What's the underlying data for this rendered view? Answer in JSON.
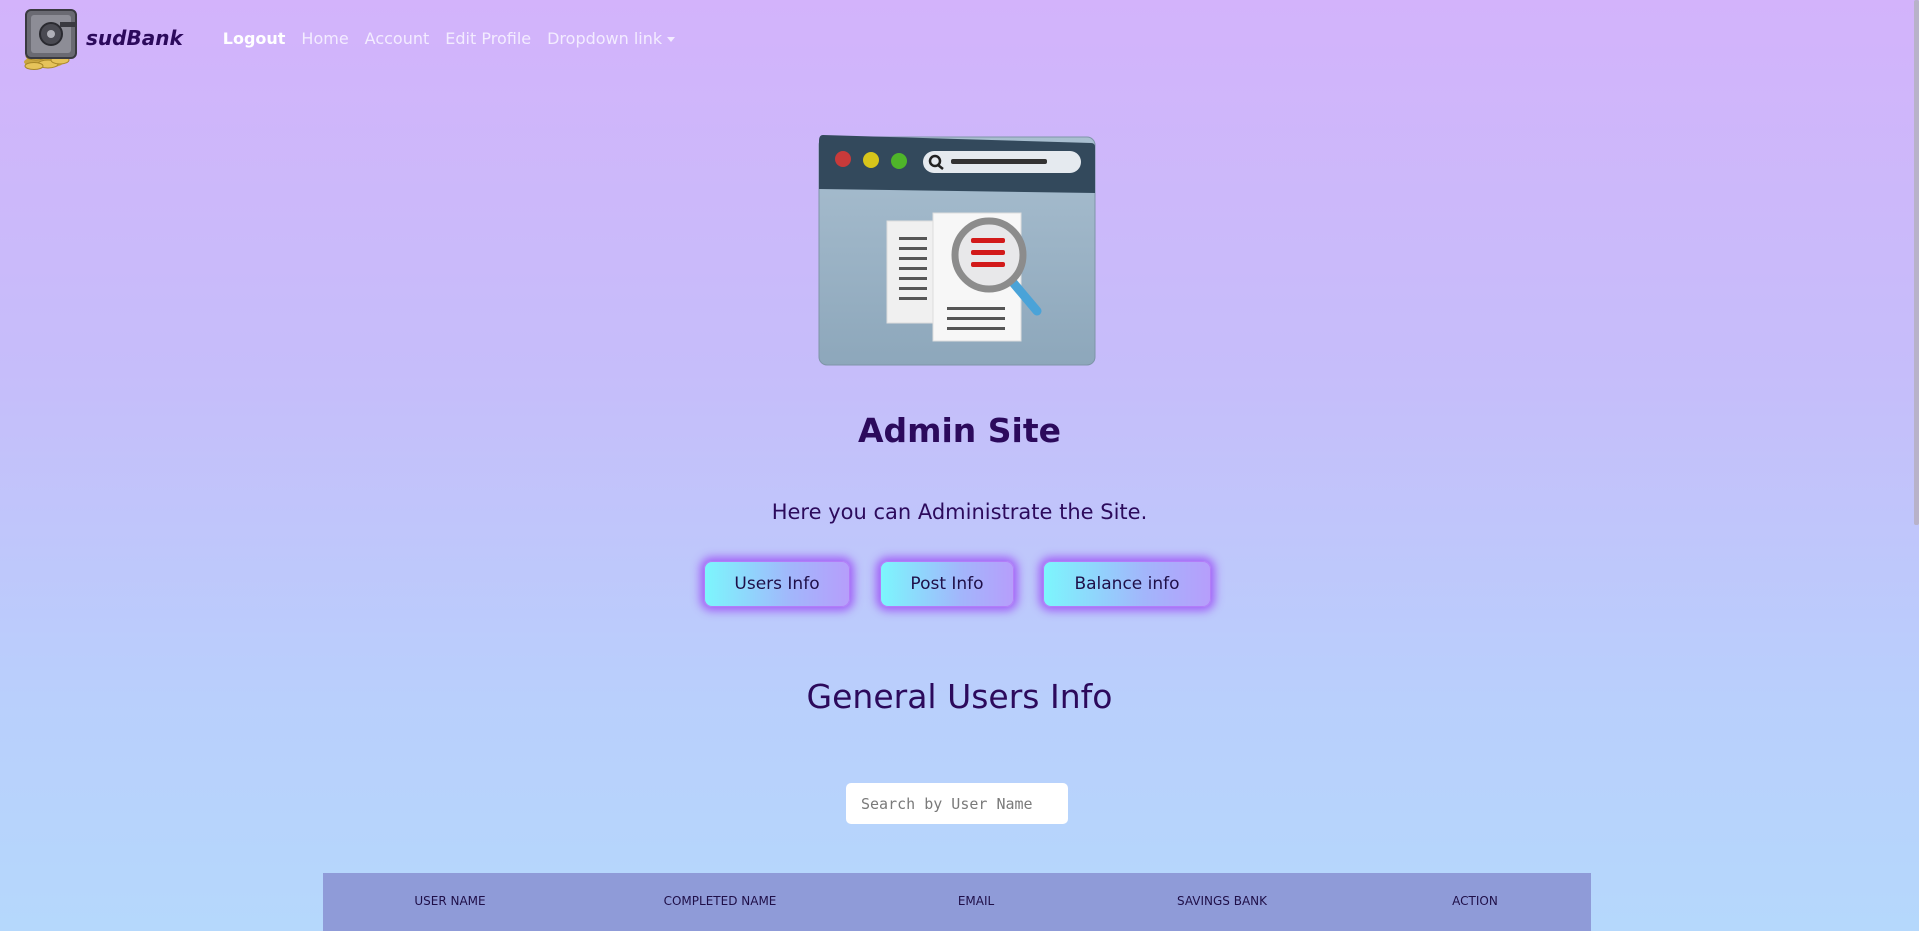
{
  "brand": {
    "name": "sudBank",
    "logo": "safe-with-coins-logo"
  },
  "nav": {
    "links": [
      "Logout",
      "Home",
      "Account",
      "Edit Profile",
      "Dropdown link"
    ]
  },
  "hero": {
    "image": "browser-window-document-search-illustration"
  },
  "page": {
    "title": "Admin Site",
    "subtitle": "Here you can Administrate the Site."
  },
  "buttons": [
    "Users Info",
    "Post Info",
    "Balance info"
  ],
  "section": {
    "title": "General Users Info"
  },
  "search": {
    "placeholder": "Search by User Name"
  },
  "table": {
    "columns": [
      "USER NAME",
      "COMPLETED NAME",
      "EMAIL",
      "SAVINGS BANK",
      "ACTION"
    ]
  },
  "colors": {
    "primary_text": "#2c0a5c",
    "button_glow": "#9c50f6",
    "table_header": "#8f9bd8"
  }
}
